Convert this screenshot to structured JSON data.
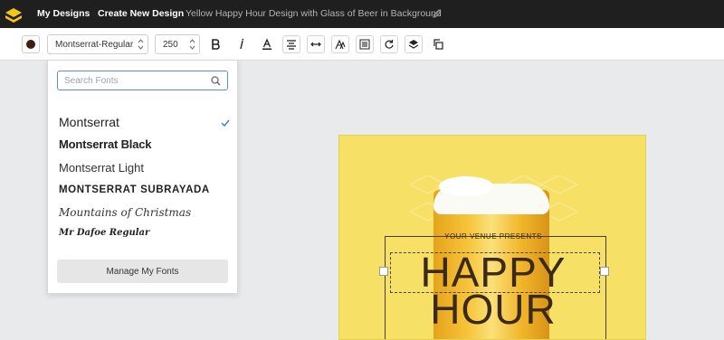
{
  "topbar": {
    "my_designs": "My Designs",
    "create_new": "Create New Design",
    "title": "Yellow Happy Hour Design with Glass of Beer in Background"
  },
  "toolbar": {
    "font_select": "Montserrat-Regular",
    "font_size": "250",
    "text_color": "#3b1f15"
  },
  "font_panel": {
    "search_placeholder": "Search Fonts",
    "fonts": [
      "Montserrat",
      "Montserrat Black",
      "Montserrat Light",
      "MONTSERRAT SUBRAYADA",
      "Mountains of Christmas",
      "Mr Dafoe Regular"
    ],
    "selected_font": "Montserrat",
    "manage_label": "Manage My Fonts"
  },
  "design": {
    "venue": "YOUR VENUE PRESENTS",
    "happy": "HAPPY",
    "hour": "HOUR",
    "background": "#f6e065",
    "text_color": "#3b2a1a"
  }
}
